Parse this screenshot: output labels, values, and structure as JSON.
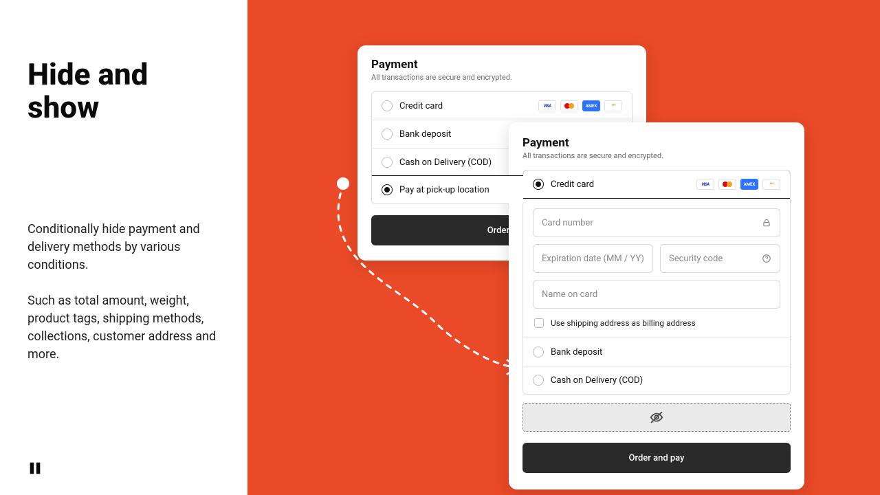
{
  "left": {
    "heading": "Hide and show",
    "body": "Conditionally hide payment and delivery methods by various conditions.\n\nSuch as total amount, weight, product tags, shipping methods, collections, customer address and more."
  },
  "common": {
    "section_title": "Payment",
    "section_sub": "All transactions are secure and encrypted."
  },
  "cardA": {
    "opts": {
      "credit": "Credit card",
      "bank": "Bank deposit",
      "cod": "Cash on Delivery (COD)",
      "pickup": "Pay at pick-up location"
    },
    "order_label": "Order a"
  },
  "cardB": {
    "selected_label": "Credit card",
    "fields": {
      "cardnum": "Card number",
      "exp": "Expiration date (MM / YY)",
      "cvc": "Security code",
      "name": "Name on card"
    },
    "billing_checkbox": "Use shipping address as billing address",
    "other": {
      "bank": "Bank deposit",
      "cod": "Cash on Delivery (COD)"
    },
    "order_label": "Order and pay"
  },
  "brands": {
    "visa": "VISA",
    "amex": "AMEX",
    "more": "•••"
  }
}
